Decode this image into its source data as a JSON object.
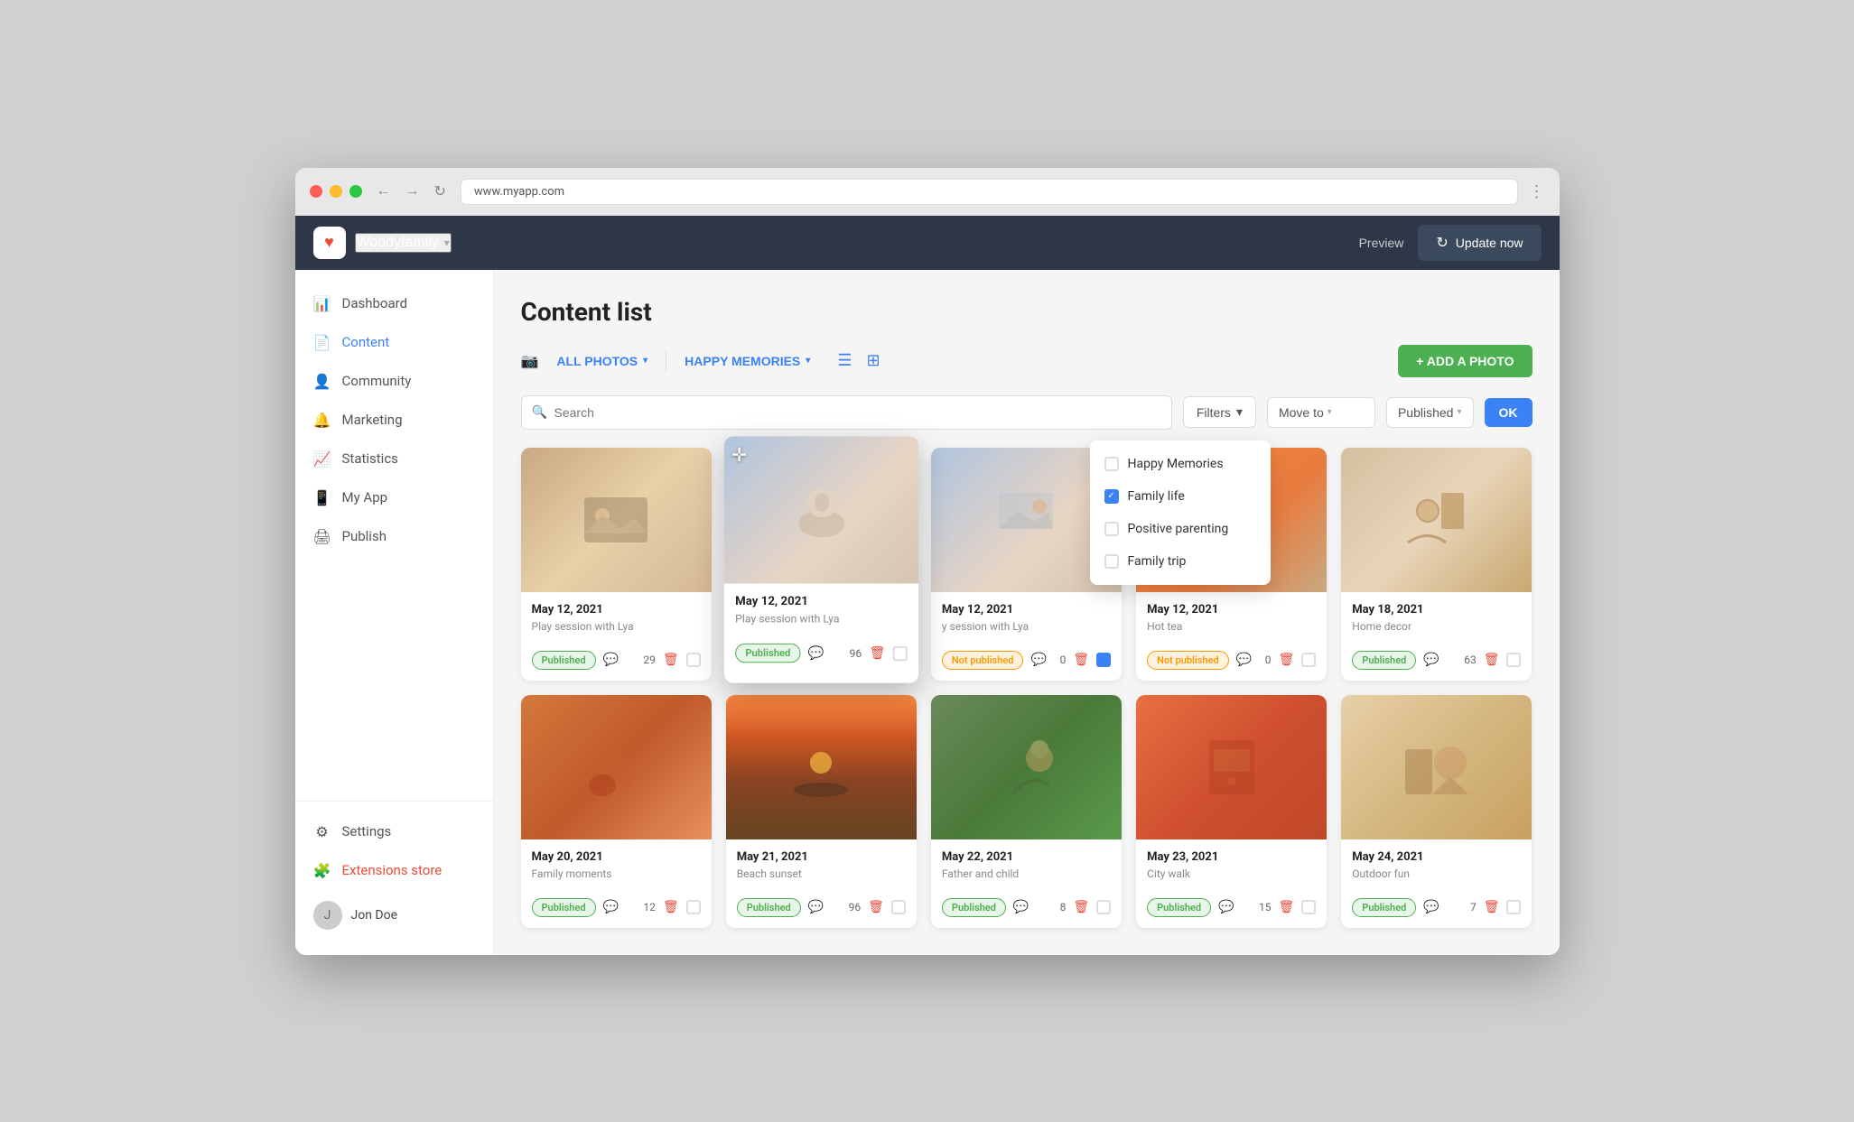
{
  "browser": {
    "url": "www.myapp.com",
    "back_btn": "←",
    "forward_btn": "→",
    "refresh_btn": "↻"
  },
  "header": {
    "logo_icon": "♥",
    "app_name": "Woodyfamily",
    "app_name_chevron": "▾",
    "preview_label": "Preview",
    "update_label": "Update now",
    "update_icon": "↻"
  },
  "sidebar": {
    "items": [
      {
        "id": "dashboard",
        "icon": "📊",
        "label": "Dashboard",
        "active": false
      },
      {
        "id": "content",
        "icon": "📄",
        "label": "Content",
        "active": true
      },
      {
        "id": "community",
        "icon": "👤",
        "label": "Community",
        "active": false
      },
      {
        "id": "marketing",
        "icon": "🔔",
        "label": "Marketing",
        "active": false
      },
      {
        "id": "statistics",
        "icon": "📈",
        "label": "Statistics",
        "active": false
      },
      {
        "id": "myapp",
        "icon": "📱",
        "label": "My App",
        "active": false
      },
      {
        "id": "publish",
        "icon": "🖨",
        "label": "Publish",
        "active": false
      }
    ],
    "bottom_items": [
      {
        "id": "settings",
        "icon": "⚙",
        "label": "Settings"
      },
      {
        "id": "extensions",
        "icon": "🧩",
        "label": "Extensions store",
        "accent": true
      }
    ],
    "user": {
      "name": "Jon Doe",
      "avatar_text": "J"
    }
  },
  "content": {
    "title": "Content list",
    "filter_all_photos": "ALL PHOTOS",
    "filter_happy_memories": "HAPPY MEMORIES",
    "add_photo_label": "+ ADD A PHOTO",
    "search_placeholder": "Search",
    "filters_label": "Filters",
    "move_to_label": "Move to",
    "published_label": "Published",
    "ok_label": "OK"
  },
  "dropdown": {
    "items": [
      {
        "id": "happy_memories",
        "label": "Happy Memories",
        "checked": false
      },
      {
        "id": "family_life",
        "label": "Family life",
        "checked": true
      },
      {
        "id": "positive_parenting",
        "label": "Positive parenting",
        "checked": false
      },
      {
        "id": "family_trip",
        "label": "Family trip",
        "checked": false
      }
    ]
  },
  "photos": [
    {
      "id": 1,
      "date": "May 12, 2021",
      "desc": "Play session with Lya",
      "status": "Published",
      "status_type": "published",
      "comments": 29,
      "checked": false,
      "img_class": "img-warm",
      "row": 1
    },
    {
      "id": 2,
      "date": "May 12, 2021",
      "desc": "Play session with Lya",
      "status": "Published",
      "status_type": "published",
      "comments": 96,
      "checked": false,
      "img_class": "img-cool",
      "row": 1,
      "dragging": true
    },
    {
      "id": 3,
      "date": "May 12, 2021",
      "desc": "y session with Lya",
      "status": "Not published",
      "status_type": "not-published",
      "comments": 0,
      "checked": true,
      "img_class": "img-cool",
      "row": 1
    },
    {
      "id": 4,
      "date": "May 12, 2021",
      "desc": "Hot tea",
      "status": "Not published",
      "status_type": "not-published",
      "comments": 0,
      "checked": false,
      "img_class": "img-orange",
      "row": 1
    },
    {
      "id": 5,
      "date": "May 18, 2021",
      "desc": "Home decor",
      "status": "Published",
      "status_type": "published",
      "comments": 63,
      "checked": false,
      "img_class": "img-warm",
      "row": 1
    },
    {
      "id": 6,
      "date": "May 20, 2021",
      "desc": "Family moments",
      "status": "Published",
      "status_type": "published",
      "comments": 12,
      "checked": false,
      "img_class": "img-sunset",
      "row": 2
    },
    {
      "id": 7,
      "date": "May 21, 2021",
      "desc": "Beach sunset",
      "status": "Published",
      "status_type": "published",
      "comments": 96,
      "checked": false,
      "img_class": "img-beach",
      "row": 2,
      "dragging": false
    },
    {
      "id": 8,
      "date": "May 22, 2021",
      "desc": "Father and child",
      "status": "Published",
      "status_type": "published",
      "comments": 8,
      "checked": false,
      "img_class": "img-green",
      "row": 2
    },
    {
      "id": 9,
      "date": "May 23, 2021",
      "desc": "City walk",
      "status": "Published",
      "status_type": "published",
      "comments": 15,
      "checked": false,
      "img_class": "img-city",
      "row": 2
    },
    {
      "id": 10,
      "date": "May 24, 2021",
      "desc": "Outdoor fun",
      "status": "Published",
      "status_type": "published",
      "comments": 7,
      "checked": false,
      "img_class": "img-orange",
      "row": 2
    }
  ]
}
